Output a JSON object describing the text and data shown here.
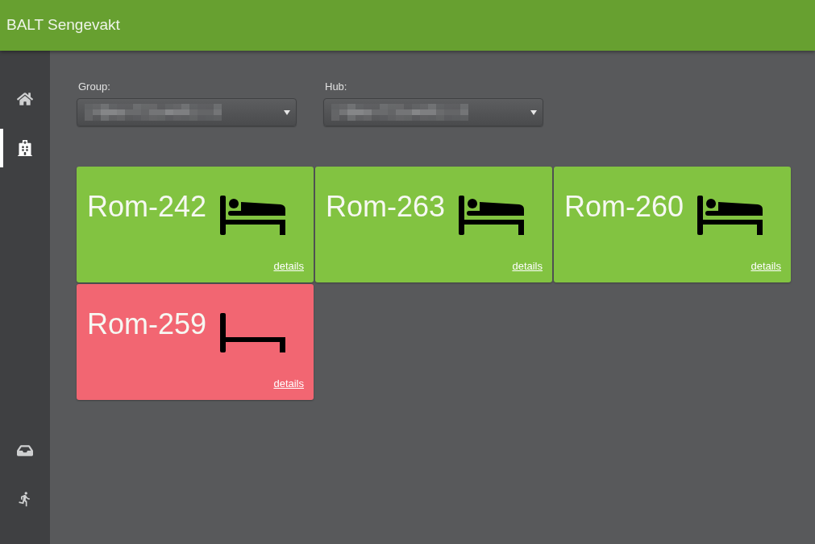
{
  "header": {
    "title": "BALT Sengevakt"
  },
  "sidebar": {
    "top_items": [
      {
        "selected": false
      },
      {
        "selected": true
      }
    ],
    "bottom_items": [
      {
        "selected": false
      },
      {
        "selected": false
      }
    ]
  },
  "filters": [
    {
      "label": "Group:",
      "value_redacted": true
    },
    {
      "label": "Hub:",
      "value_redacted": true
    }
  ],
  "rooms": [
    {
      "name": "Rom-242",
      "occupied": true,
      "link": "details"
    },
    {
      "name": "Rom-263",
      "occupied": true,
      "link": "details"
    },
    {
      "name": "Rom-260",
      "occupied": true,
      "link": "details"
    },
    {
      "name": "Rom-259",
      "occupied": false,
      "link": "details"
    }
  ]
}
